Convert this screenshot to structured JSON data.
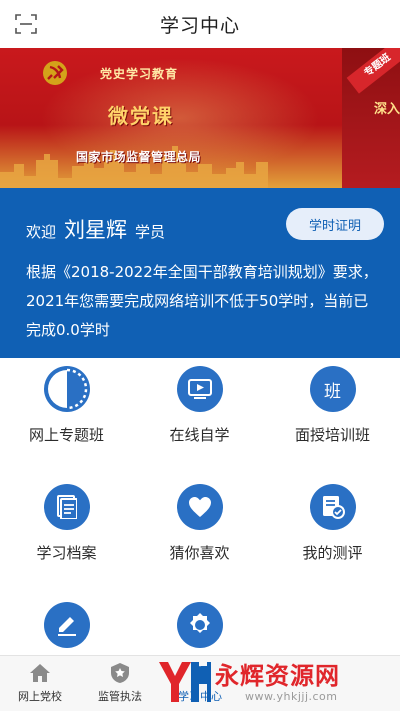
{
  "header": {
    "title": "学习中心",
    "scan_icon": "scan-icon"
  },
  "banner": {
    "top_text": "党史学习教育",
    "main_text": "微党课",
    "sub_text": "国家市场监督管理总局",
    "ribbon_text": "专题班",
    "side_text": "深入",
    "colors": {
      "red": "#c9191d",
      "gold": "#ffd36a"
    }
  },
  "user_card": {
    "welcome": "欢迎",
    "name": "刘星辉",
    "role": "学员",
    "cert_button": "学时证明",
    "notice": "根据《2018-2022年全国干部教育培训规划》要求，2021年您需要完成网络培训不低于50学时，当前已完成0.0学时",
    "accent": "#1060b4"
  },
  "grid": [
    {
      "label": "网上专题班",
      "icon": "progress-circle-icon"
    },
    {
      "label": "在线自学",
      "icon": "video-play-icon"
    },
    {
      "label": "面授培训班",
      "icon": "class-icon",
      "glyph": "班"
    },
    {
      "label": "学习档案",
      "icon": "document-icon"
    },
    {
      "label": "猜你喜欢",
      "icon": "heart-icon"
    },
    {
      "label": "我的测评",
      "icon": "evaluation-icon"
    },
    {
      "label": "",
      "icon": "edit-icon"
    },
    {
      "label": "",
      "icon": "settings-gear-icon"
    }
  ],
  "bottom_nav": [
    {
      "label": "网上党校",
      "icon": "home-icon"
    },
    {
      "label": "监管执法",
      "icon": "badge-star-icon"
    },
    {
      "label": "学习中心",
      "icon": "study-icon",
      "active": true
    }
  ],
  "watermark": {
    "text": "永辉资源网",
    "url": "www.yhkjjj.com"
  }
}
